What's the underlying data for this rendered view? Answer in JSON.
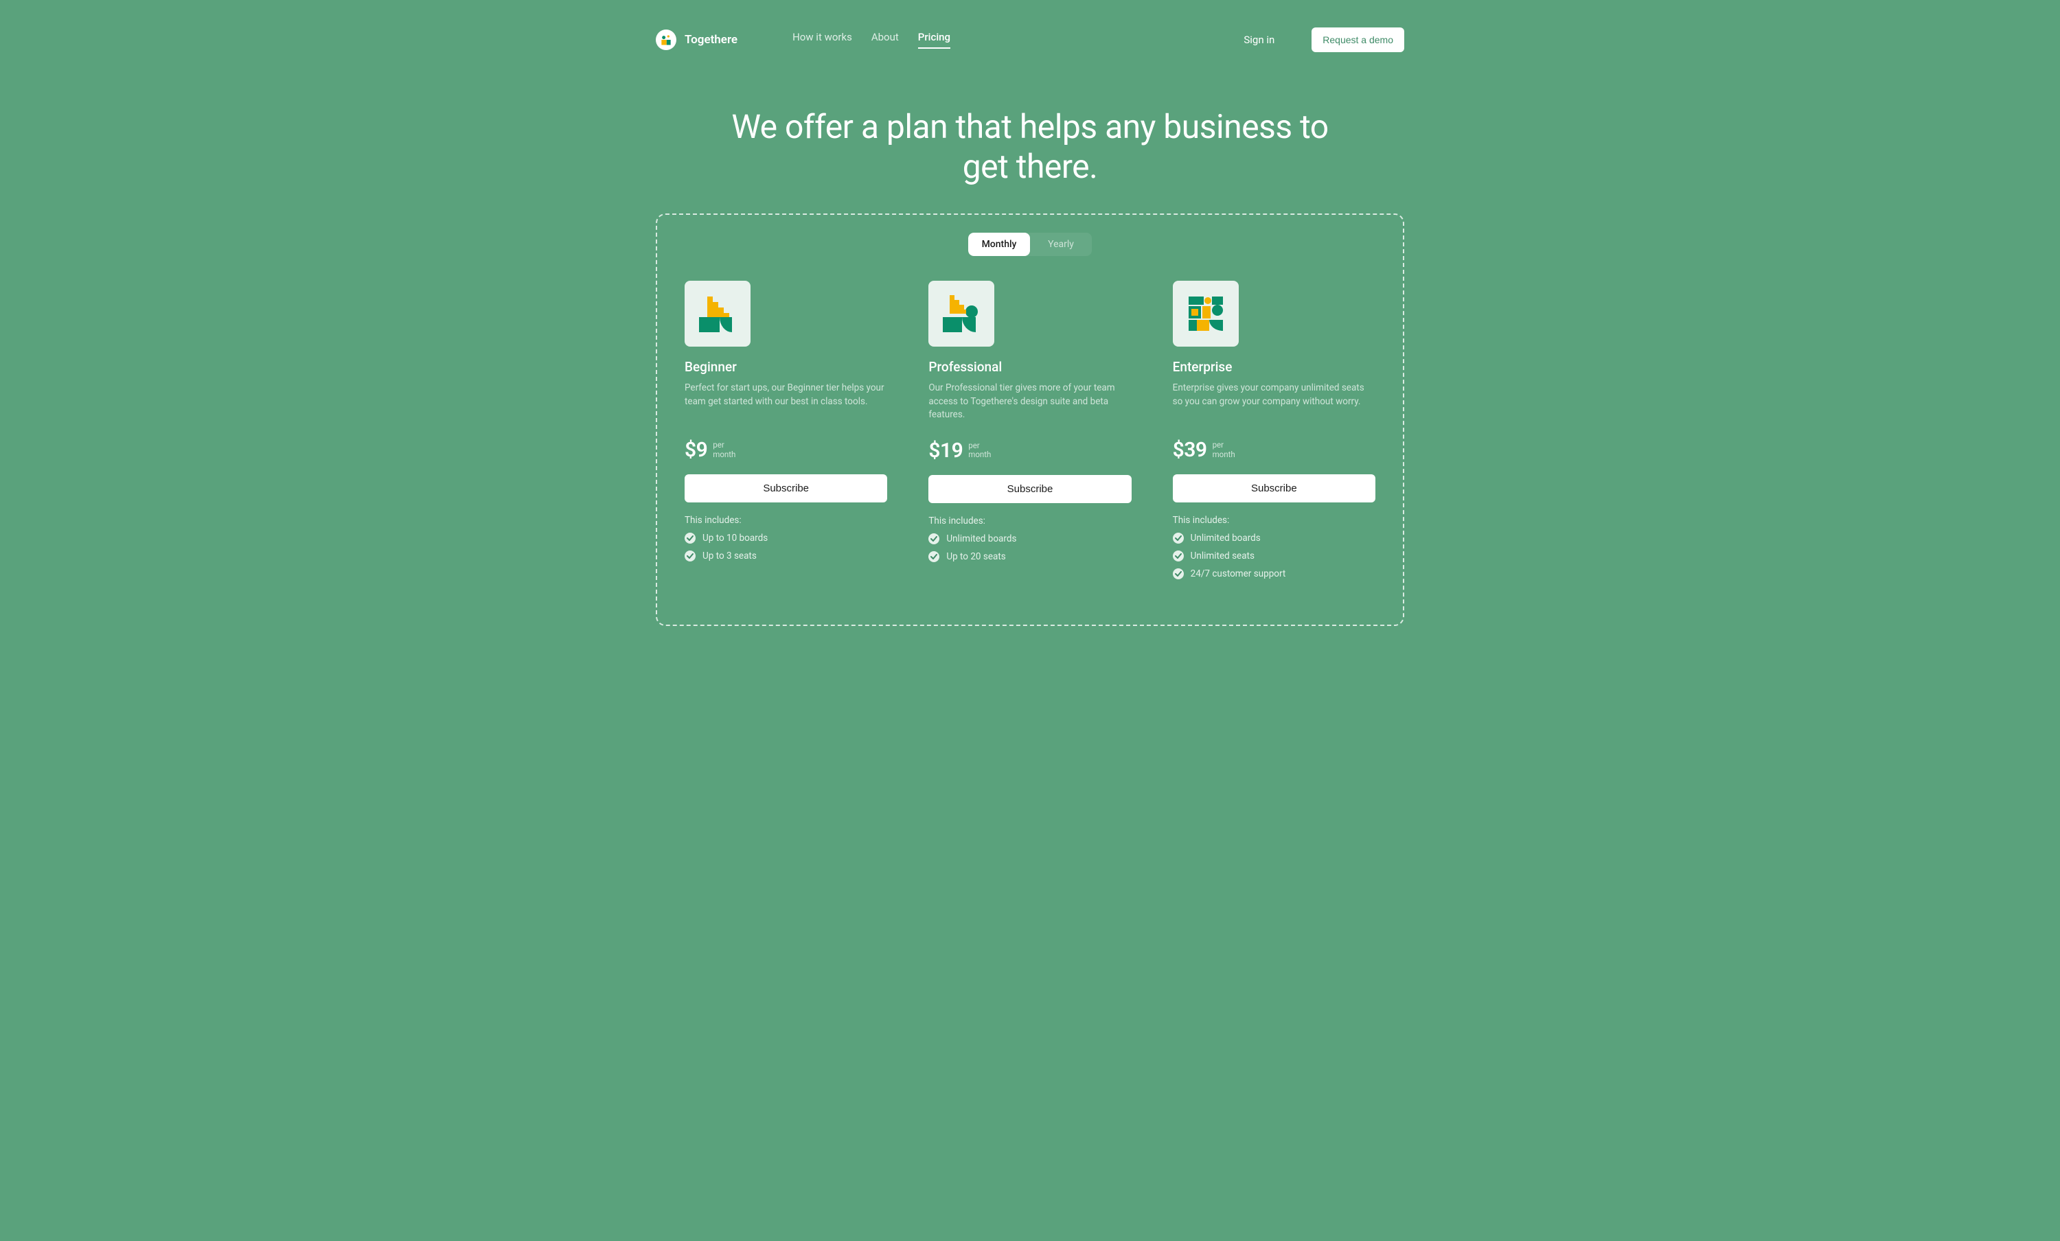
{
  "brand": "Togethere",
  "nav": {
    "items": [
      "How it works",
      "About",
      "Pricing"
    ],
    "active_index": 2
  },
  "header": {
    "signin": "Sign in",
    "demo_cta": "Request a demo"
  },
  "hero": {
    "title": "We offer a plan that helps any business to get there."
  },
  "billing_toggle": {
    "monthly": "Monthly",
    "yearly": "Yearly",
    "active": "monthly"
  },
  "price_unit": {
    "per": "per",
    "interval": "month"
  },
  "includes_heading": "This includes:",
  "subscribe_label": "Subscribe",
  "plans": [
    {
      "name": "Beginner",
      "description": "Perfect for start ups, our Beginner tier helps your team get started with our best in class tools.",
      "price": "$9",
      "features": [
        "Up to 10 boards",
        "Up to 3 seats"
      ]
    },
    {
      "name": "Professional",
      "description": "Our Professional tier gives more of your team access to Togethere's design suite and beta features.",
      "price": "$19",
      "features": [
        "Unlimited boards",
        "Up to 20 seats"
      ]
    },
    {
      "name": "Enterprise",
      "description": "Enterprise gives your company unlimited seats so you can grow your company without worry.",
      "price": "$39",
      "features": [
        "Unlimited boards",
        "Unlimited seats",
        "24/7 customer support"
      ]
    }
  ]
}
